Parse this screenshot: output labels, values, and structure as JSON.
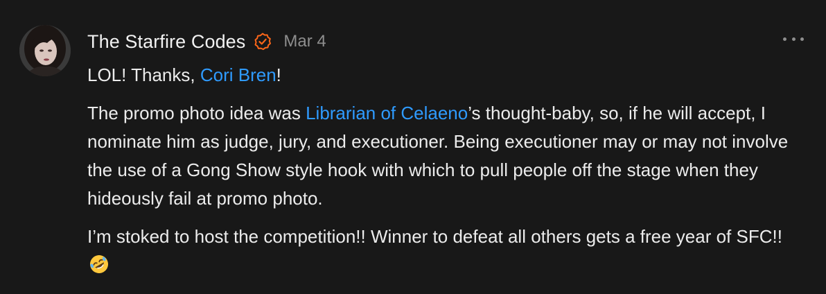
{
  "comment": {
    "author": "The Starfire Codes",
    "verified_icon": "verified-badge-icon",
    "date": "Mar 4",
    "more_icon": "ellipsis-icon",
    "colors": {
      "background": "#181818",
      "text": "#ececec",
      "mention": "#2f9bff",
      "badge": "#ff6719",
      "meta": "#8e8e8e"
    },
    "paragraphs": [
      {
        "segments": [
          {
            "text": "LOL! Thanks, ",
            "type": "text"
          },
          {
            "text": "Cori Bren",
            "type": "mention"
          },
          {
            "text": "!",
            "type": "text"
          }
        ]
      },
      {
        "segments": [
          {
            "text": "The promo photo idea was ",
            "type": "text"
          },
          {
            "text": "Librarian of Celaeno",
            "type": "mention"
          },
          {
            "text": "’s thought-baby, so, if he will accept, I nominate him as judge, jury, and executioner. Being executioner may or may not involve the use of a Gong Show style hook with which to pull people off the stage when they hideously fail at promo photo.",
            "type": "text"
          }
        ]
      },
      {
        "segments": [
          {
            "text": "I’m stoked to host the competition!! Winner to defeat all others gets a free year of SFC!! ",
            "type": "text"
          }
        ],
        "emoji": "rolling-on-floor-laughing-emoji"
      }
    ]
  }
}
